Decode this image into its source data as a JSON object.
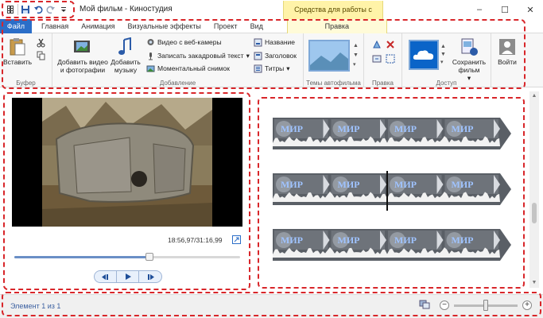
{
  "window": {
    "title": "Мой фильм - Киностудия",
    "context_title": "Средства для работы с видео",
    "controls": [
      "–",
      "☐",
      "✕"
    ]
  },
  "tabs": [
    {
      "label": "Файл"
    },
    {
      "label": "Главная"
    },
    {
      "label": "Анимация"
    },
    {
      "label": "Визуальные эффекты"
    },
    {
      "label": "Проект"
    },
    {
      "label": "Вид"
    },
    {
      "label": "Правка"
    }
  ],
  "ribbon": {
    "buffer": {
      "label": "Буфер",
      "paste": "Вставить"
    },
    "adding": {
      "label": "Добавление",
      "add_video": "Добавить видео и фотографии",
      "add_music": "Добавить музыку",
      "webcam": "Видео с веб-камеры",
      "narration": "Записать закадровый текст",
      "snapshot": "Моментальный снимок",
      "caption": "Название",
      "title": "Заголовок",
      "credits": "Титры"
    },
    "themes": {
      "label": "Темы автофильма"
    },
    "edit": {
      "label": "Правка"
    },
    "share": {
      "label": "Доступ",
      "save_movie": "Сохранить фильм"
    },
    "signin": {
      "label": "Войти"
    }
  },
  "preview": {
    "timecode": "18:56,97/31:16,99",
    "progress": 0.6
  },
  "storyboard": {
    "clip_text": "МИР",
    "rows": 3,
    "tiles_per_row": 4
  },
  "status": {
    "text": "Элемент 1 из 1",
    "zoom_level": 0.5
  },
  "colors": {
    "file_tab": "#2b6ec8",
    "context": "#fff3a8",
    "annotation": "#d8262a",
    "onedrive": "#0a64c8"
  }
}
